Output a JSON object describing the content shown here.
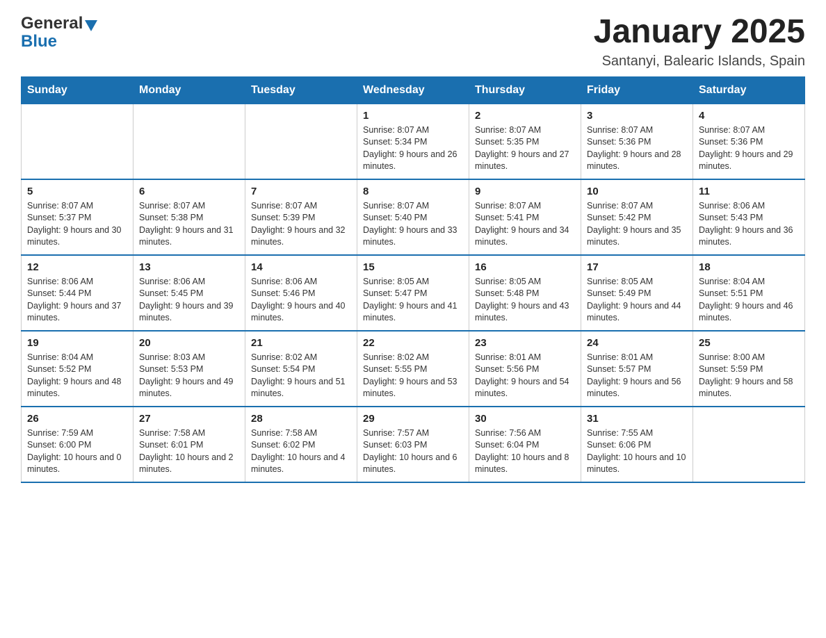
{
  "logo": {
    "general": "General",
    "blue": "Blue"
  },
  "title": "January 2025",
  "subtitle": "Santanyi, Balearic Islands, Spain",
  "days_of_week": [
    "Sunday",
    "Monday",
    "Tuesday",
    "Wednesday",
    "Thursday",
    "Friday",
    "Saturday"
  ],
  "weeks": [
    {
      "days": [
        {
          "number": "",
          "info": ""
        },
        {
          "number": "",
          "info": ""
        },
        {
          "number": "",
          "info": ""
        },
        {
          "number": "1",
          "info": "Sunrise: 8:07 AM\nSunset: 5:34 PM\nDaylight: 9 hours and 26 minutes."
        },
        {
          "number": "2",
          "info": "Sunrise: 8:07 AM\nSunset: 5:35 PM\nDaylight: 9 hours and 27 minutes."
        },
        {
          "number": "3",
          "info": "Sunrise: 8:07 AM\nSunset: 5:36 PM\nDaylight: 9 hours and 28 minutes."
        },
        {
          "number": "4",
          "info": "Sunrise: 8:07 AM\nSunset: 5:36 PM\nDaylight: 9 hours and 29 minutes."
        }
      ]
    },
    {
      "days": [
        {
          "number": "5",
          "info": "Sunrise: 8:07 AM\nSunset: 5:37 PM\nDaylight: 9 hours and 30 minutes."
        },
        {
          "number": "6",
          "info": "Sunrise: 8:07 AM\nSunset: 5:38 PM\nDaylight: 9 hours and 31 minutes."
        },
        {
          "number": "7",
          "info": "Sunrise: 8:07 AM\nSunset: 5:39 PM\nDaylight: 9 hours and 32 minutes."
        },
        {
          "number": "8",
          "info": "Sunrise: 8:07 AM\nSunset: 5:40 PM\nDaylight: 9 hours and 33 minutes."
        },
        {
          "number": "9",
          "info": "Sunrise: 8:07 AM\nSunset: 5:41 PM\nDaylight: 9 hours and 34 minutes."
        },
        {
          "number": "10",
          "info": "Sunrise: 8:07 AM\nSunset: 5:42 PM\nDaylight: 9 hours and 35 minutes."
        },
        {
          "number": "11",
          "info": "Sunrise: 8:06 AM\nSunset: 5:43 PM\nDaylight: 9 hours and 36 minutes."
        }
      ]
    },
    {
      "days": [
        {
          "number": "12",
          "info": "Sunrise: 8:06 AM\nSunset: 5:44 PM\nDaylight: 9 hours and 37 minutes."
        },
        {
          "number": "13",
          "info": "Sunrise: 8:06 AM\nSunset: 5:45 PM\nDaylight: 9 hours and 39 minutes."
        },
        {
          "number": "14",
          "info": "Sunrise: 8:06 AM\nSunset: 5:46 PM\nDaylight: 9 hours and 40 minutes."
        },
        {
          "number": "15",
          "info": "Sunrise: 8:05 AM\nSunset: 5:47 PM\nDaylight: 9 hours and 41 minutes."
        },
        {
          "number": "16",
          "info": "Sunrise: 8:05 AM\nSunset: 5:48 PM\nDaylight: 9 hours and 43 minutes."
        },
        {
          "number": "17",
          "info": "Sunrise: 8:05 AM\nSunset: 5:49 PM\nDaylight: 9 hours and 44 minutes."
        },
        {
          "number": "18",
          "info": "Sunrise: 8:04 AM\nSunset: 5:51 PM\nDaylight: 9 hours and 46 minutes."
        }
      ]
    },
    {
      "days": [
        {
          "number": "19",
          "info": "Sunrise: 8:04 AM\nSunset: 5:52 PM\nDaylight: 9 hours and 48 minutes."
        },
        {
          "number": "20",
          "info": "Sunrise: 8:03 AM\nSunset: 5:53 PM\nDaylight: 9 hours and 49 minutes."
        },
        {
          "number": "21",
          "info": "Sunrise: 8:02 AM\nSunset: 5:54 PM\nDaylight: 9 hours and 51 minutes."
        },
        {
          "number": "22",
          "info": "Sunrise: 8:02 AM\nSunset: 5:55 PM\nDaylight: 9 hours and 53 minutes."
        },
        {
          "number": "23",
          "info": "Sunrise: 8:01 AM\nSunset: 5:56 PM\nDaylight: 9 hours and 54 minutes."
        },
        {
          "number": "24",
          "info": "Sunrise: 8:01 AM\nSunset: 5:57 PM\nDaylight: 9 hours and 56 minutes."
        },
        {
          "number": "25",
          "info": "Sunrise: 8:00 AM\nSunset: 5:59 PM\nDaylight: 9 hours and 58 minutes."
        }
      ]
    },
    {
      "days": [
        {
          "number": "26",
          "info": "Sunrise: 7:59 AM\nSunset: 6:00 PM\nDaylight: 10 hours and 0 minutes."
        },
        {
          "number": "27",
          "info": "Sunrise: 7:58 AM\nSunset: 6:01 PM\nDaylight: 10 hours and 2 minutes."
        },
        {
          "number": "28",
          "info": "Sunrise: 7:58 AM\nSunset: 6:02 PM\nDaylight: 10 hours and 4 minutes."
        },
        {
          "number": "29",
          "info": "Sunrise: 7:57 AM\nSunset: 6:03 PM\nDaylight: 10 hours and 6 minutes."
        },
        {
          "number": "30",
          "info": "Sunrise: 7:56 AM\nSunset: 6:04 PM\nDaylight: 10 hours and 8 minutes."
        },
        {
          "number": "31",
          "info": "Sunrise: 7:55 AM\nSunset: 6:06 PM\nDaylight: 10 hours and 10 minutes."
        },
        {
          "number": "",
          "info": ""
        }
      ]
    }
  ]
}
